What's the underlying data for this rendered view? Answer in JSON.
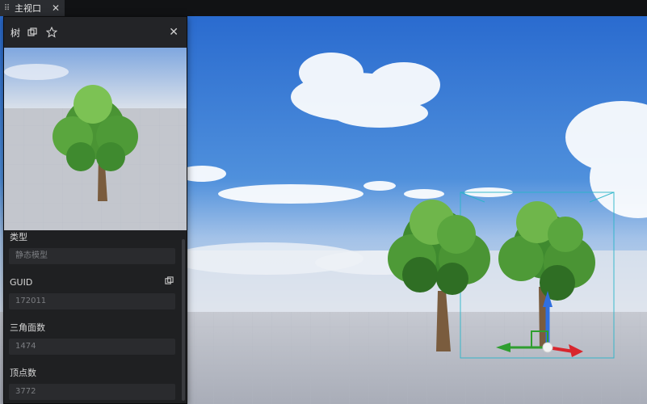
{
  "tab": {
    "label": "主视口",
    "grip_icon": "grip-icon",
    "close_icon": "close-icon"
  },
  "panel": {
    "title": "树",
    "icons": [
      "copy-icon",
      "star-icon",
      "close-icon"
    ],
    "properties": [
      {
        "label": "类型",
        "value": "静态模型"
      },
      {
        "label": "GUID",
        "value": "172011"
      },
      {
        "label": "三角面数",
        "value": "1474"
      },
      {
        "label": "顶点数",
        "value": "3772"
      }
    ]
  },
  "colors": {
    "sky_top": "#2e6fd0",
    "sky_bottom": "#a8c4e6",
    "ground": "#b9bdc6",
    "gizmo_x": "#d8262d",
    "gizmo_y": "#2f9e2f",
    "gizmo_z": "#2f6fe0",
    "selection_box": "#29b5c9"
  }
}
